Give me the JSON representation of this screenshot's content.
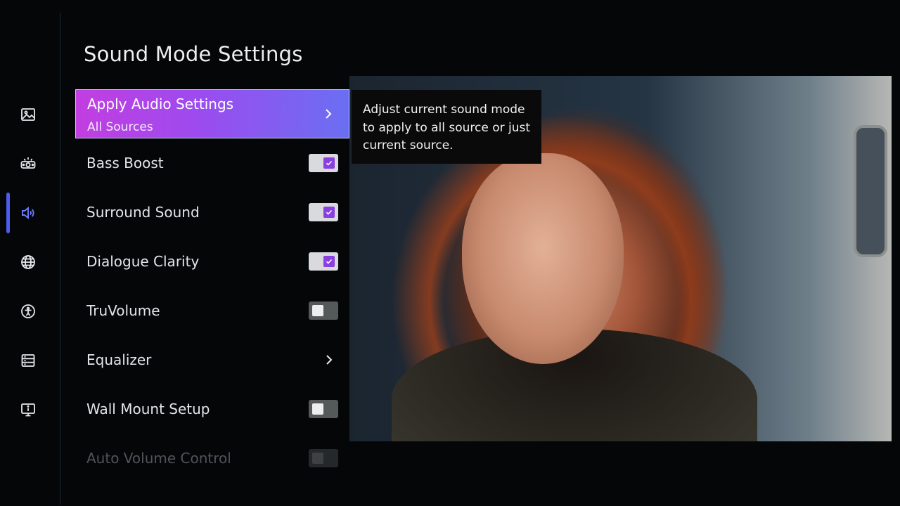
{
  "page": {
    "title": "Sound Mode Settings"
  },
  "rail": {
    "items": [
      {
        "icon": "picture-icon",
        "label": ""
      },
      {
        "icon": "projector-icon",
        "label": ""
      },
      {
        "icon": "speaker-icon",
        "label": ""
      },
      {
        "icon": "globe-icon",
        "label": ""
      },
      {
        "icon": "accessibility-icon",
        "label": ""
      },
      {
        "icon": "server-icon",
        "label": ""
      },
      {
        "icon": "tv-info-icon",
        "label": ""
      }
    ],
    "active_index": 2,
    "accent": "#4d5cf0"
  },
  "menu": {
    "items": [
      {
        "label": "Apply Audio Settings",
        "sub": "All Sources",
        "control": "chevron",
        "selected": true
      },
      {
        "label": "Bass Boost",
        "control": "toggle",
        "checked": true
      },
      {
        "label": "Surround Sound",
        "control": "toggle",
        "checked": true
      },
      {
        "label": "Dialogue Clarity",
        "control": "toggle",
        "checked": true
      },
      {
        "label": "TruVolume",
        "control": "toggle",
        "checked": false
      },
      {
        "label": "Equalizer",
        "control": "chevron"
      },
      {
        "label": "Wall Mount Setup",
        "control": "toggle",
        "checked": false
      },
      {
        "label": "Auto Volume Control",
        "control": "toggle",
        "checked": false,
        "disabled": true
      }
    ],
    "highlight_colors": [
      "#c23ee0",
      "#9c4bef",
      "#6a6ff2"
    ]
  },
  "tooltip": {
    "text": "Adjust current sound mode to apply to all source or just current source."
  }
}
